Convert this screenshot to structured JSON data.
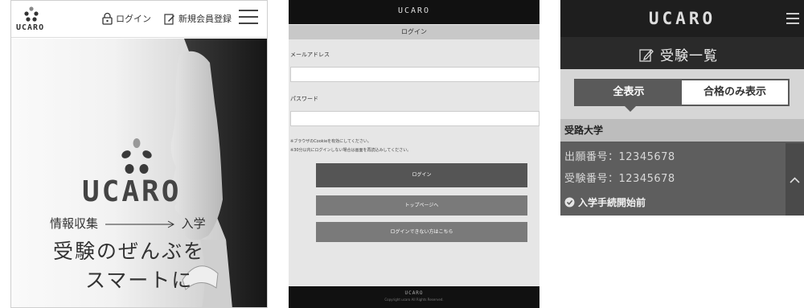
{
  "landing": {
    "brand": "UCARO",
    "login_label": "ログイン",
    "register_label": "新規会員登録",
    "hero_brand": "UCARO",
    "tagline_start": "情報収集",
    "tagline_end": "入学",
    "headline_line1": "受験のぜんぶを",
    "headline_line2": "スマートに"
  },
  "login_form": {
    "header_brand": "UCARO",
    "title": "ログイン",
    "email_label": "メールアドレス",
    "password_label": "パスワード",
    "note1": "※ブラウザのCookieを有効にしてください。",
    "note2": "※30分以内にログインしない場合は画面を再読込みしてください。",
    "login_button": "ログイン",
    "top_button": "トップページへ",
    "help_button": "ログインできない方はこちら",
    "footer_brand": "UCARO",
    "footer_copy": "Copyright ucaro All Rights Reserved."
  },
  "exam_list": {
    "brand": "UCARO",
    "title": "受験一覧",
    "tab_all": "全表示",
    "tab_passed": "合格のみ表示",
    "university": "受路大学",
    "application_no": "出願番号：12345678",
    "exam_no": "受験番号：12345678",
    "status": "入学手続開始前"
  }
}
